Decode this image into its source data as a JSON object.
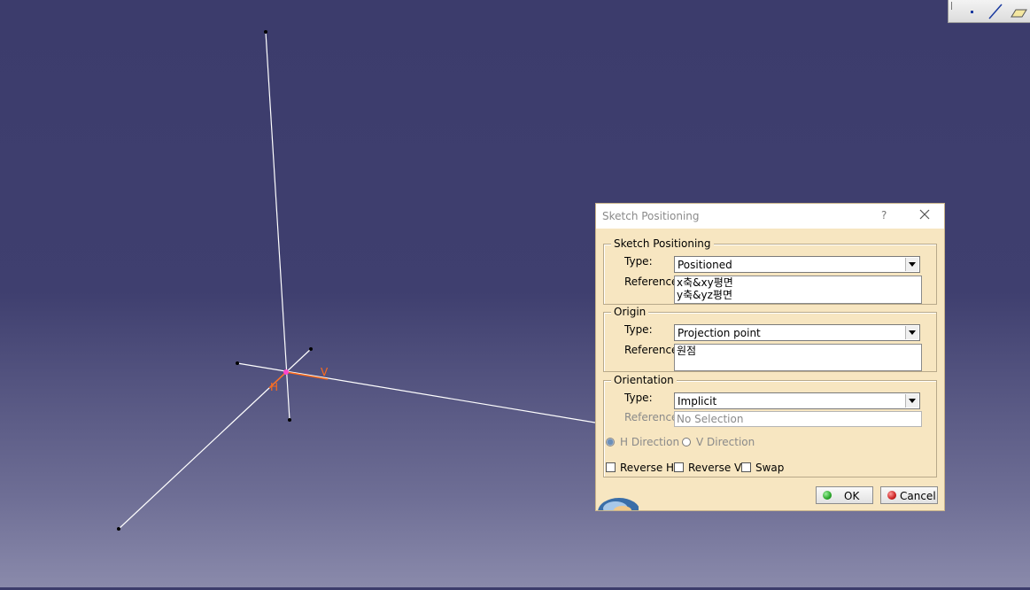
{
  "viewport": {
    "axis_labels": {
      "h": "H",
      "v": "V"
    }
  },
  "toolbar": {
    "icons": [
      "point-icon",
      "line-icon",
      "plane-icon"
    ]
  },
  "dialog": {
    "title": "Sketch Positioning",
    "help": "?",
    "sketch_positioning": {
      "legend": "Sketch Positioning",
      "type_label": "Type:",
      "type_value": "Positioned",
      "reference_label": "Reference:",
      "references": [
        "x축&xy평면",
        "y축&yz평면"
      ]
    },
    "origin": {
      "legend": "Origin",
      "type_label": "Type:",
      "type_value": "Projection point",
      "reference_label": "Reference:",
      "references": [
        "원점"
      ]
    },
    "orientation": {
      "legend": "Orientation",
      "type_label": "Type:",
      "type_value": "Implicit",
      "reference_label": "Reference:",
      "reference_value": "No Selection",
      "h_direction": "H Direction",
      "v_direction": "V Direction",
      "reverse_h": "Reverse H",
      "reverse_v": "Reverse V",
      "swap": "Swap"
    },
    "buttons": {
      "ok": "OK",
      "cancel": "Cancel"
    },
    "colors": {
      "background": "#f7e6c1",
      "ok_dot": "#2aa62a",
      "cancel_dot": "#cc2222"
    }
  }
}
